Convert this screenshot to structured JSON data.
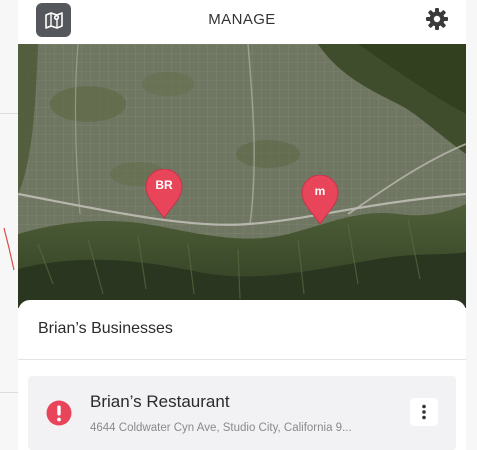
{
  "header": {
    "title": "MANAGE",
    "left_icon": "map-icon",
    "right_icon": "gear-icon"
  },
  "map": {
    "pins": [
      {
        "label": "BR"
      },
      {
        "label": "m"
      }
    ],
    "pin_color": "#e8455a"
  },
  "businesses": {
    "title": "Brian’s Businesses",
    "items": [
      {
        "name": "Brian’s Restaurant",
        "address": "4644 Coldwater Cyn Ave, Studio City, California 9...",
        "status_icon": "alert-icon",
        "status_color": "#e8455a",
        "menu_icon": "more-vertical-icon"
      }
    ]
  }
}
